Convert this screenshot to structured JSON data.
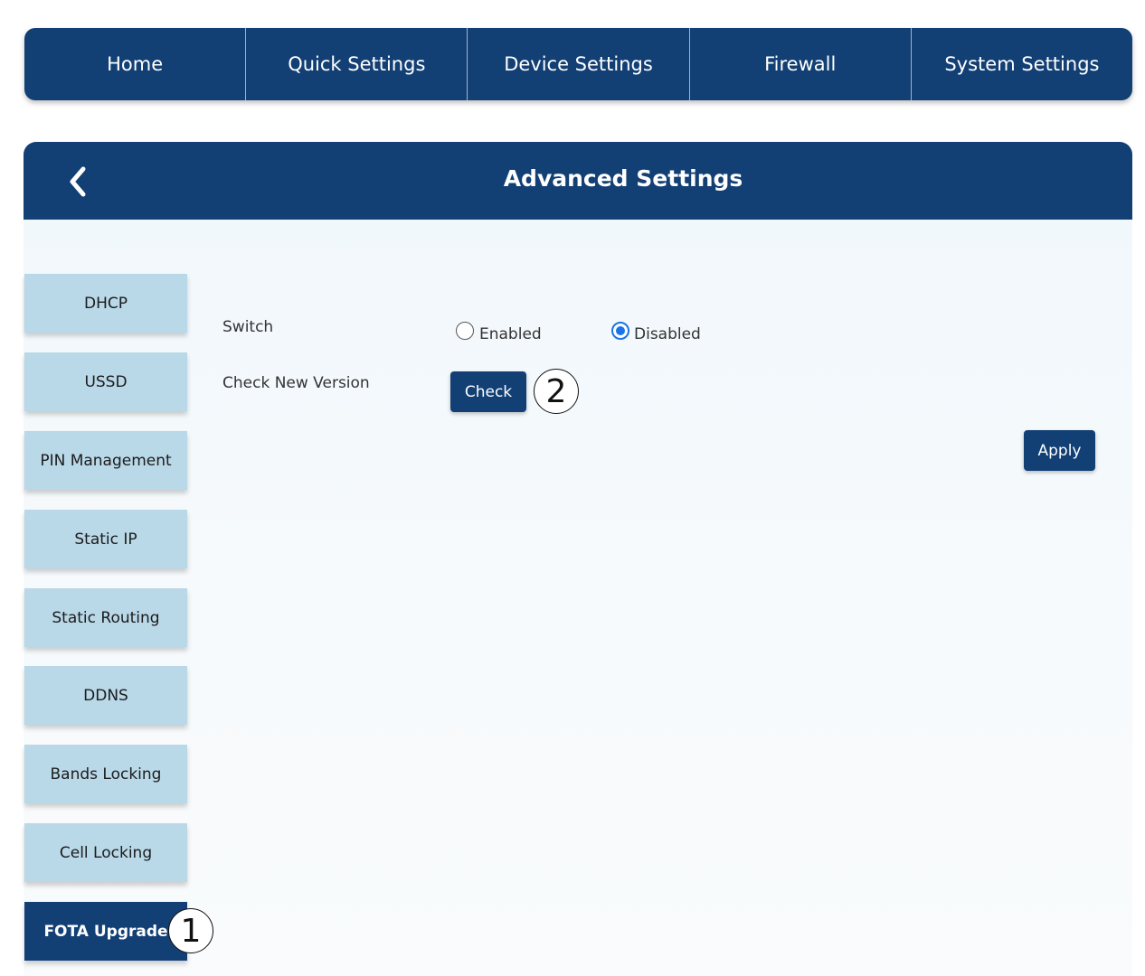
{
  "nav": {
    "items": [
      {
        "label": "Home"
      },
      {
        "label": "Quick Settings"
      },
      {
        "label": "Device Settings"
      },
      {
        "label": "Firewall"
      },
      {
        "label": "System Settings"
      }
    ]
  },
  "header": {
    "title": "Advanced Settings",
    "back_icon": "chevron-left-icon"
  },
  "sidebar": {
    "items": [
      {
        "label": "DHCP"
      },
      {
        "label": "USSD"
      },
      {
        "label": "PIN Management"
      },
      {
        "label": "Static IP"
      },
      {
        "label": "Static Routing"
      },
      {
        "label": "DDNS"
      },
      {
        "label": "Bands Locking"
      },
      {
        "label": "Cell Locking"
      },
      {
        "label": "FOTA Upgrade",
        "active": true
      }
    ]
  },
  "form": {
    "switch_label": "Switch",
    "switch_options": {
      "enabled_label": "Enabled",
      "disabled_label": "Disabled",
      "selected": "Disabled"
    },
    "check_version_label": "Check New Version",
    "check_button": "Check",
    "apply_button": "Apply"
  },
  "markers": {
    "first": "1",
    "second": "2"
  },
  "colors": {
    "primary": "#123f74",
    "sidebar_item": "#b9d8e8",
    "radio_selected": "#1a73e8"
  }
}
